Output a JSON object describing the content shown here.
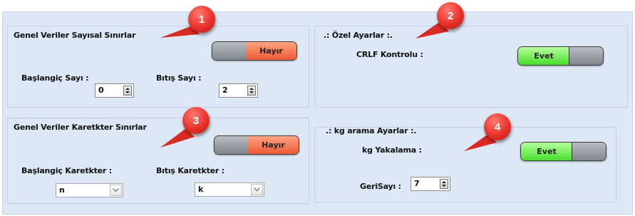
{
  "groups": {
    "sayisal": {
      "title": "Genel Veriler Sayısal Sınırlar",
      "toggle": {
        "label": "Hayır",
        "state": "off"
      },
      "start_label": "Başlangiç Sayı :",
      "start_value": "0",
      "end_label": "Bıtış Sayı :",
      "end_value": "2"
    },
    "ozel": {
      "title": ".: Özel Ayarlar :.",
      "crlf_label": "CRLF Kontrolu :",
      "toggle": {
        "label": "Evet",
        "state": "on"
      }
    },
    "karakter": {
      "title": "Genel Veriler Karetkter Sınırlar",
      "toggle": {
        "label": "Hayır",
        "state": "off"
      },
      "start_label": "Başlangiç Karetkter :",
      "start_value": "n",
      "end_label": "Bıtış Karetkter :",
      "end_value": "k"
    },
    "kg": {
      "title": ".: kg arama Ayarlar :.",
      "capture_label": "kg Yakalama :",
      "toggle": {
        "label": "Evet",
        "state": "on"
      },
      "countdown_label": "GeriSayı :",
      "countdown_value": "7"
    }
  },
  "callouts": [
    "1",
    "2",
    "3",
    "4"
  ],
  "colors": {
    "panel_bg": "#dde8f6",
    "toggle_off": "#ec5a33",
    "toggle_on": "#47dd2b",
    "callout": "#e8322b"
  }
}
